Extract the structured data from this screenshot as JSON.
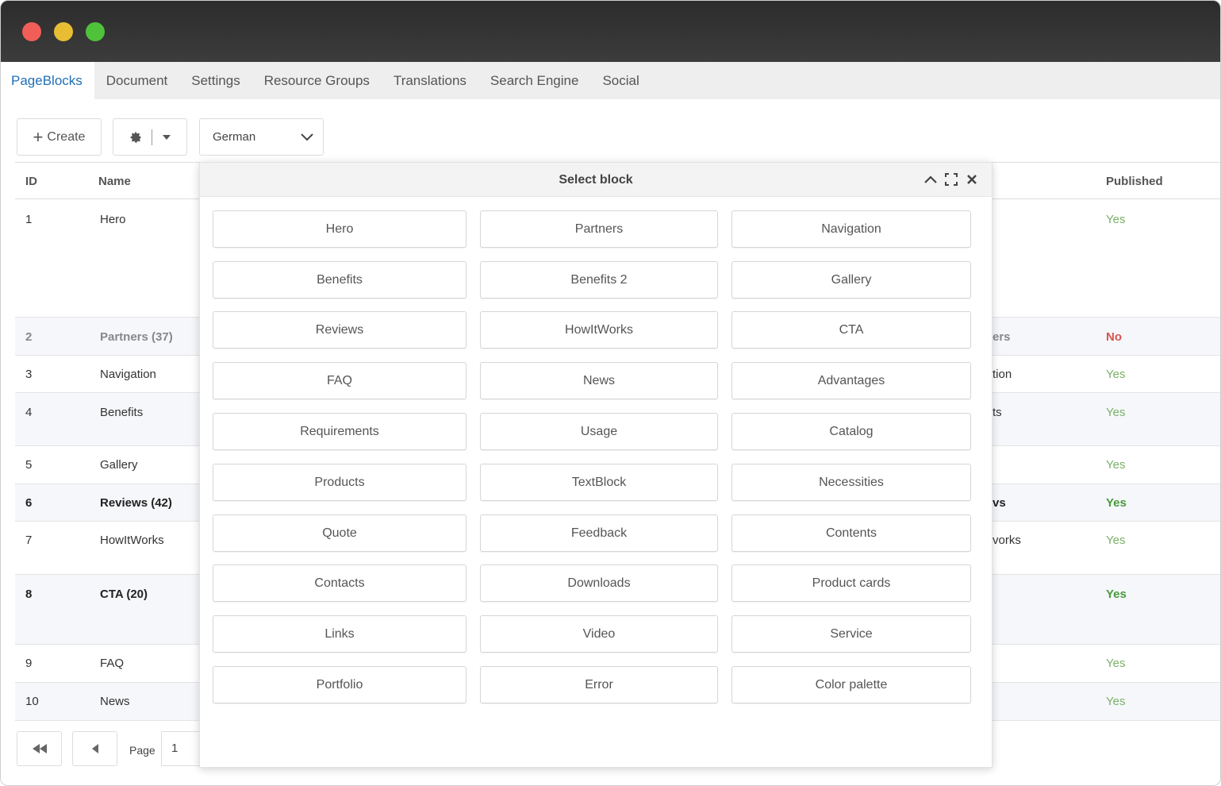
{
  "tabs": [
    "PageBlocks",
    "Document",
    "Settings",
    "Resource Groups",
    "Translations",
    "Search Engine",
    "Social"
  ],
  "toolbar": {
    "create_label": "Create",
    "language": "German"
  },
  "grid": {
    "headers": {
      "id": "ID",
      "name": "Name",
      "published": "Published"
    },
    "rows": [
      {
        "id": "1",
        "name": "Hero",
        "partial": "",
        "published": "Yes"
      },
      {
        "id": "2",
        "name": "Partners (37)",
        "partial": "ers",
        "published": "No"
      },
      {
        "id": "3",
        "name": "Navigation",
        "partial": "tion",
        "published": "Yes"
      },
      {
        "id": "4",
        "name": "Benefits",
        "partial": "ts",
        "published": "Yes"
      },
      {
        "id": "5",
        "name": "Gallery",
        "partial": "",
        "published": "Yes"
      },
      {
        "id": "6",
        "name": "Reviews (42)",
        "partial": "vs",
        "published": "Yes"
      },
      {
        "id": "7",
        "name": "HowItWorks",
        "partial": "vorks",
        "published": "Yes"
      },
      {
        "id": "8",
        "name": "CTA (20)",
        "partial": "",
        "published": "Yes"
      },
      {
        "id": "9",
        "name": "FAQ",
        "partial": "",
        "published": "Yes"
      },
      {
        "id": "10",
        "name": "News",
        "partial": "",
        "published": "Yes"
      }
    ]
  },
  "pager": {
    "page_label": "Page",
    "page_value": "1"
  },
  "dialog": {
    "title": "Select block",
    "blocks": [
      "Hero",
      "Partners",
      "Navigation",
      "Benefits",
      "Benefits 2",
      "Gallery",
      "Reviews",
      "HowItWorks",
      "CTA",
      "FAQ",
      "News",
      "Advantages",
      "Requirements",
      "Usage",
      "Catalog",
      "Products",
      "TextBlock",
      "Necessities",
      "Quote",
      "Feedback",
      "Contents",
      "Contacts",
      "Downloads",
      "Product cards",
      "Links",
      "Video",
      "Service",
      "Portfolio",
      "Error",
      "Color palette"
    ]
  },
  "icons": {
    "create": "plus-icon",
    "settings": "gear-icon",
    "dropdown": "caret-down-icon",
    "select_chevron": "chevron-down-icon",
    "collapse": "chevron-up-icon",
    "maximize": "maximize-icon",
    "close": "close-icon",
    "first_page": "double-left-icon",
    "prev_page": "triangle-left-icon"
  },
  "colors": {
    "active_tab": "#1e6fb8",
    "yes": "#7bb069",
    "no": "#d9534f"
  }
}
